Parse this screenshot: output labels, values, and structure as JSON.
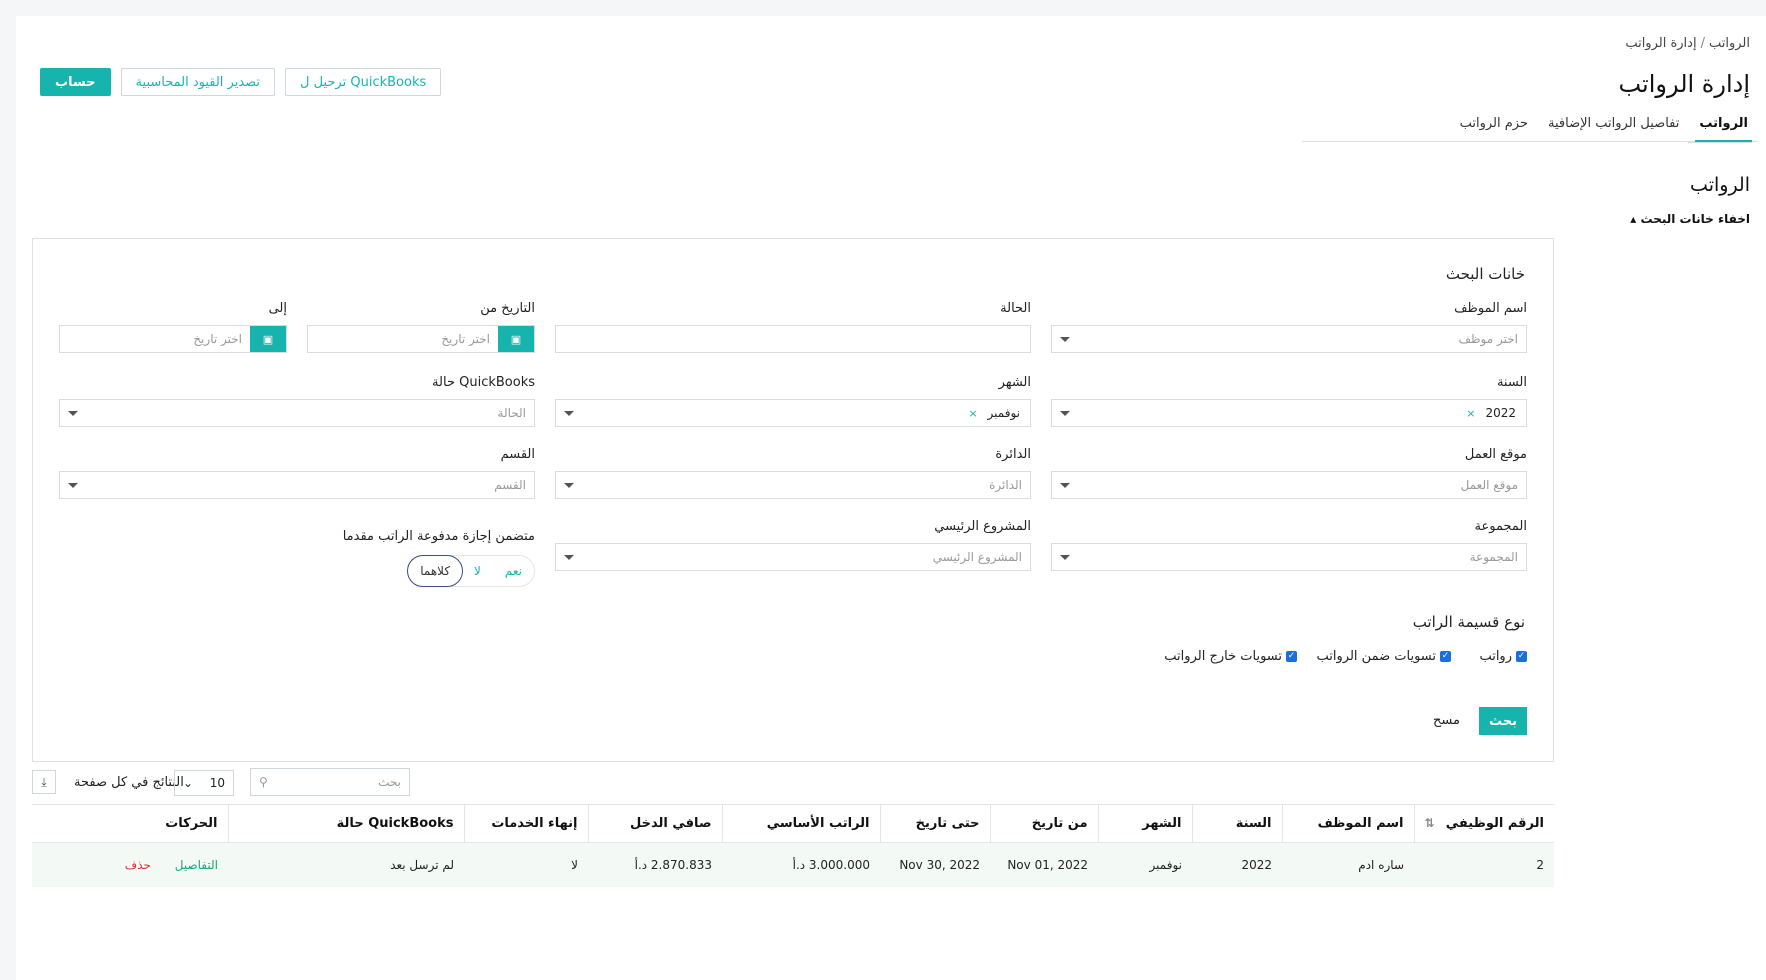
{
  "breadcrumb": {
    "root": "الرواتب",
    "current": "إدارة الرواتب"
  },
  "page_title": "إدارة الرواتب",
  "actions": {
    "primary": "حساب",
    "export_entries": "تصدير القيود المحاسبية",
    "post_quickbooks": "ترحيل ل QuickBooks"
  },
  "tabs": [
    {
      "label": "الرواتب",
      "active": true
    },
    {
      "label": "تفاصيل الرواتب الإضافية",
      "active": false
    },
    {
      "label": "حزم الرواتب",
      "active": false
    }
  ],
  "section_title": "الرواتب",
  "toggle_search": "اخفاء خانات البحث",
  "search": {
    "title": "خانات البحث",
    "employee": {
      "label": "اسم الموظف",
      "placeholder": "اختر موظف"
    },
    "status": {
      "label": "الحالة",
      "value": ""
    },
    "date_from": {
      "label": "التاريخ من",
      "placeholder": "اختر تاريخ"
    },
    "date_to": {
      "label": "إلى",
      "placeholder": "اختر تاريخ"
    },
    "year": {
      "label": "السنة",
      "value": "2022",
      "clear": "×"
    },
    "month": {
      "label": "الشهر",
      "value": "نوفمبر",
      "clear": "×"
    },
    "qb_status": {
      "label": "QuickBooks حالة",
      "placeholder": "الحالة"
    },
    "work_location": {
      "label": "موقع العمل",
      "placeholder": "موقع العمل"
    },
    "department": {
      "label": "الدائرة",
      "placeholder": "الدائرة"
    },
    "section": {
      "label": "القسم",
      "placeholder": "القسم"
    },
    "group": {
      "label": "المجموعة",
      "placeholder": "المجموعة"
    },
    "main_project": {
      "label": "المشروع الرئيسي",
      "placeholder": "المشروع الرئيسي"
    },
    "prepaid_leave": {
      "label": "متضمن إجازة مدفوعة الراتب مقدما",
      "options": [
        "نعم",
        "لا",
        "كلاهما"
      ],
      "selected": "كلاهما"
    },
    "slip_type": {
      "title": "نوع قسيمة الراتب",
      "options": [
        {
          "label": "رواتب",
          "checked": true
        },
        {
          "label": "تسويات ضمن الرواتب",
          "checked": true
        },
        {
          "label": "تسويات خارج الرواتب",
          "checked": true
        }
      ]
    },
    "search_button": "بحث",
    "clear_button": "مسح"
  },
  "table_tools": {
    "search_placeholder": "بحث",
    "per_page": "10",
    "per_page_label": "النتائج في كل صفحة"
  },
  "table": {
    "columns": [
      "الرقم الوظيفي",
      "اسم الموظف",
      "السنة",
      "الشهر",
      "من تاريخ",
      "حتى تاريخ",
      "الراتب الأساسي",
      "صافي الدخل",
      "إنهاء الخدمات",
      "QuickBooks حالة",
      "الحركات"
    ],
    "rows": [
      {
        "id": "2",
        "name": "ساره ادم",
        "year": "2022",
        "month": "نوفمبر",
        "from": "Nov 01, 2022",
        "to": "Nov 30, 2022",
        "basic": "3.000.000 د.أ",
        "net": "2.870.833 د.أ",
        "termination": "لا",
        "qb_status": "لم ترسل بعد",
        "details": "التفاصيل",
        "delete": "حذف"
      }
    ]
  },
  "colors": {
    "accent": "#17b3ad",
    "danger": "#e03030",
    "link": "#1aa37a"
  }
}
